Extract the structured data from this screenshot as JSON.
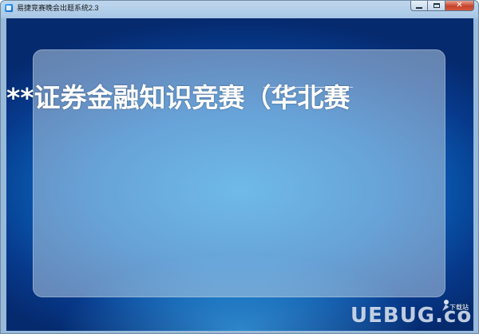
{
  "window": {
    "title": "易捷竞赛晚会出题系统2.3",
    "icon": "app-icon",
    "caption": {
      "minimize_icon": "minimize-icon",
      "maximize_icon": "maximize-icon",
      "close_icon": "close-icon"
    }
  },
  "stage": {
    "headline": "**证券金融知识竞赛（华北赛"
  },
  "watermark": {
    "logo_text": "UEBUG.com",
    "site_label": "下载站"
  }
}
